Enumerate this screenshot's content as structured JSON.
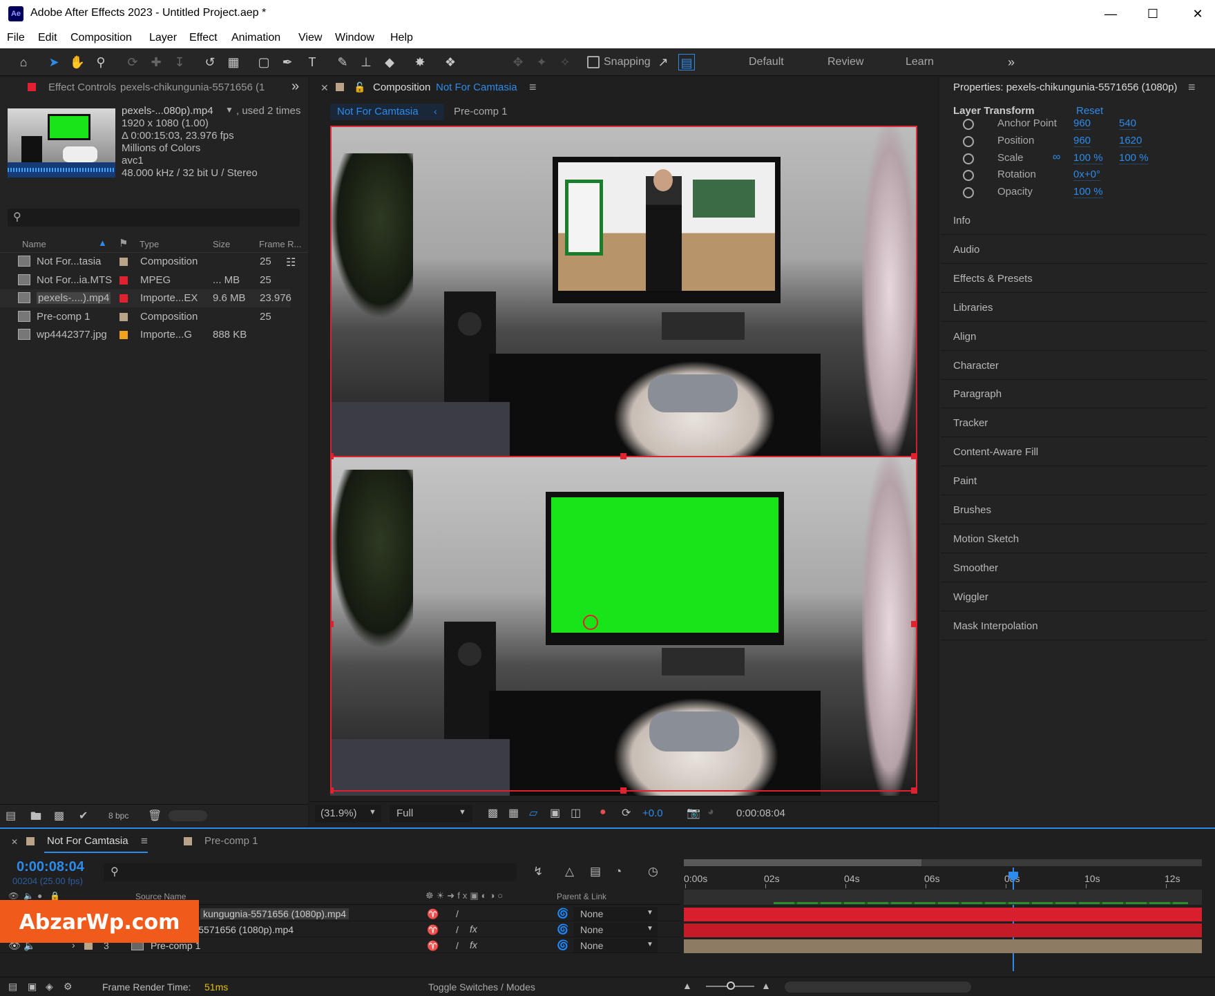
{
  "window": {
    "app_icon": "Ae",
    "title": "Adobe After Effects 2023 - Untitled Project.aep *"
  },
  "menu": [
    "File",
    "Edit",
    "Composition",
    "Layer",
    "Effect",
    "Animation",
    "View",
    "Window",
    "Help"
  ],
  "toolbar": {
    "snapping_label": "Snapping",
    "workspaces": [
      "Default",
      "Review",
      "Learn"
    ]
  },
  "project_panel": {
    "tab_label": "Effect Controls",
    "tab_file": "pexels-chikungunia-5571656 (1",
    "info": {
      "filename": "pexels-...080p).mp4",
      "used": ", used 2 times",
      "dimensions": "1920 x 1080 (1.00)",
      "duration": "Δ 0:00:15:03, 23.976 fps",
      "colors": "Millions of Colors",
      "codec": "avc1",
      "audio": "48.000 kHz / 32 bit U / Stereo"
    },
    "columns": [
      "Name",
      "Type",
      "Size",
      "Frame R..."
    ],
    "items": [
      {
        "name": "Not For...tasia",
        "type": "Composition",
        "size": "",
        "fps": "25",
        "color": "#b9a48a"
      },
      {
        "name": "Not For...ia.MTS",
        "type": "MPEG",
        "size": "... MB",
        "fps": "25",
        "color": "#e0212f"
      },
      {
        "name": "pexels-....).mp4",
        "type": "Importe...EX",
        "size": "9.6 MB",
        "fps": "23.976",
        "color": "#e0212f"
      },
      {
        "name": "Pre-comp 1",
        "type": "Composition",
        "size": "",
        "fps": "25",
        "color": "#b9a48a"
      },
      {
        "name": "wp4442377.jpg",
        "type": "Importe...G",
        "size": "888 KB",
        "fps": "",
        "color": "#f2a21c"
      }
    ],
    "bpc": "8 bpc"
  },
  "comp_panel": {
    "tab_prefix": "Composition",
    "tab_name": "Not For Camtasia",
    "breadcrumbs": [
      "Not For Camtasia",
      "Pre-comp 1"
    ],
    "zoom": "(31.9%)",
    "resolution": "Full",
    "exposure": "+0.0",
    "timecode": "0:00:08:04"
  },
  "properties_panel": {
    "title": "Properties: pexels-chikungunia-5571656 (1080p)",
    "section": "Layer Transform",
    "reset": "Reset",
    "props": [
      {
        "label": "Anchor Point",
        "v1": "960",
        "v2": "540"
      },
      {
        "label": "Position",
        "v1": "960",
        "v2": "1620"
      },
      {
        "label": "Scale",
        "v1": "100 %",
        "v2": "100 %"
      },
      {
        "label": "Rotation",
        "v1": "0x+0°",
        "v2": ""
      },
      {
        "label": "Opacity",
        "v1": "100 %",
        "v2": ""
      }
    ],
    "groups": [
      "Info",
      "Audio",
      "Effects & Presets",
      "Libraries",
      "Align",
      "Character",
      "Paragraph",
      "Tracker",
      "Content-Aware Fill",
      "Paint",
      "Brushes",
      "Motion Sketch",
      "Smoother",
      "Wiggler",
      "Mask Interpolation"
    ]
  },
  "timeline": {
    "tabs": [
      "Not For Camtasia",
      "Pre-comp 1"
    ],
    "timecode": "0:00:08:04",
    "frames": "00204 (25.00 fps)",
    "col_source": "Source Name",
    "col_parent": "Parent & Link",
    "ruler": [
      "0:00s",
      "02s",
      "04s",
      "06s",
      "08s",
      "10s",
      "12s"
    ],
    "layers": [
      {
        "num": "1",
        "name": "kungugnia-5571656 (1080p).mp4",
        "parent": "None",
        "bar": "#d81f2e"
      },
      {
        "num": "2",
        "name": "kungugnia-5571656 (1080p).mp4",
        "parent": "None",
        "bar": "#c41b28"
      },
      {
        "num": "3",
        "name": "Pre-comp 1",
        "parent": "None",
        "bar": "#8e7b64"
      }
    ],
    "render_label": "Frame Render Time:",
    "render_value": "51ms",
    "toggle": "Toggle Switches / Modes"
  },
  "watermark": "AbzarWp.com",
  "colors": {
    "accent": "#2d8ceb",
    "green_screen": "#17e517",
    "selection": "#e0212f"
  }
}
